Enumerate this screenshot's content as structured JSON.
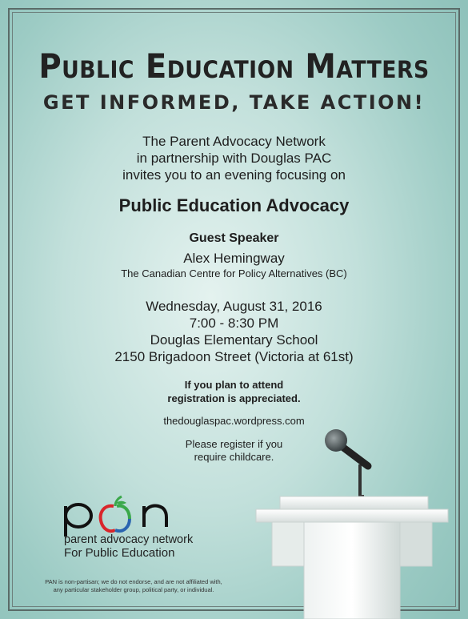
{
  "headline": "Public Education Matters",
  "subheadline": "GET INFORMED, TAKE ACTION!",
  "intro": {
    "line1": "The Parent Advocacy Network",
    "line2": "in partnership with Douglas PAC",
    "line3": "invites you to an evening focusing on"
  },
  "event_title": "Public Education Advocacy",
  "guest": {
    "label": "Guest Speaker",
    "name": "Alex Hemingway",
    "organization": "The Canadian Centre for Policy Alternatives (BC)"
  },
  "event": {
    "date": "Wednesday, August 31, 2016",
    "time": "7:00 - 8:30 PM",
    "venue": "Douglas Elementary School",
    "address": "2150 Brigadoon Street (Victoria at 61st)"
  },
  "attend": {
    "line1": "If you plan to attend",
    "line2": "registration is appreciated."
  },
  "website": "thedouglaspac.wordpress.com",
  "childcare": {
    "line1": "Please register if you",
    "line2": "require childcare."
  },
  "logo": {
    "wordmark": "pan",
    "line1": "parent advocacy network",
    "line2": "For Public Education"
  },
  "disclaimer": {
    "line1": "PAN is non-partisan; we do not endorse, and are not affiliated with,",
    "line2": "any particular stakeholder group, political party, or individual."
  },
  "colors": {
    "background": "#a9d3cd",
    "text": "#1e1e1e",
    "apple_red": "#d9262b",
    "apple_green": "#3aa84a",
    "apple_blue": "#2a64b0"
  },
  "icons": [
    "apple-logo-icon",
    "microphone-icon",
    "podium-icon"
  ]
}
